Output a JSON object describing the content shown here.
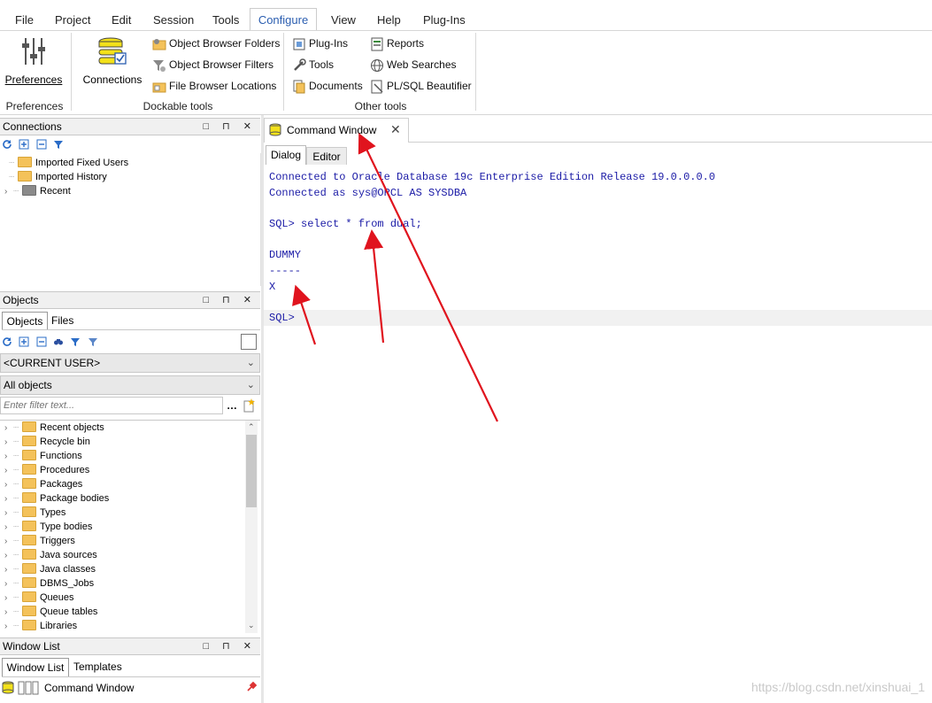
{
  "menu": {
    "items": [
      "File",
      "Project",
      "Edit",
      "Session",
      "Tools",
      "Configure",
      "View",
      "Help",
      "Plug-Ins"
    ]
  },
  "ribbon": {
    "preferences": {
      "label": "Preferences",
      "group": "Preferences"
    },
    "connections": {
      "label": "Connections"
    },
    "dockable": {
      "group": "Dockable tools",
      "items": [
        "Object Browser Folders",
        "Object Browser Filters",
        "File Browser Locations"
      ]
    },
    "other": {
      "group": "Other tools",
      "col1": [
        "Plug-Ins",
        "Tools",
        "Documents"
      ],
      "col2": [
        "Reports",
        "Web Searches",
        "PL/SQL Beautifier"
      ]
    }
  },
  "connections_panel": {
    "title": "Connections",
    "tree": [
      "Imported Fixed Users",
      "Imported History",
      "Recent"
    ]
  },
  "objects_panel": {
    "title": "Objects",
    "tabs": [
      "Objects",
      "Files"
    ],
    "user_combo": "<CURRENT USER>",
    "filter_combo": "All objects",
    "filter_placeholder": "Enter filter text...",
    "tree": [
      "Recent objects",
      "Recycle bin",
      "Functions",
      "Procedures",
      "Packages",
      "Package bodies",
      "Types",
      "Type bodies",
      "Triggers",
      "Java sources",
      "Java classes",
      "DBMS_Jobs",
      "Queues",
      "Queue tables",
      "Libraries"
    ]
  },
  "window_list_panel": {
    "title": "Window List",
    "tabs": [
      "Window List",
      "Templates"
    ],
    "items": [
      "Command Window"
    ]
  },
  "editor": {
    "doc_tab": "Command Window",
    "subtabs": [
      "Dialog",
      "Editor"
    ],
    "lines": [
      "Connected to Oracle Database 19c Enterprise Edition Release 19.0.0.0.0",
      "Connected as sys@ORCL AS SYSDBA",
      "",
      "SQL> select * from dual;",
      "",
      "DUMMY",
      "-----",
      "X",
      "",
      "SQL> "
    ]
  },
  "watermark": "https://blog.csdn.net/xinshuai_1",
  "colors": {
    "accent": "#2a5db0",
    "sql_text": "#1a1aa6",
    "arrow": "#e0141e",
    "folder": "#f4c25a"
  }
}
